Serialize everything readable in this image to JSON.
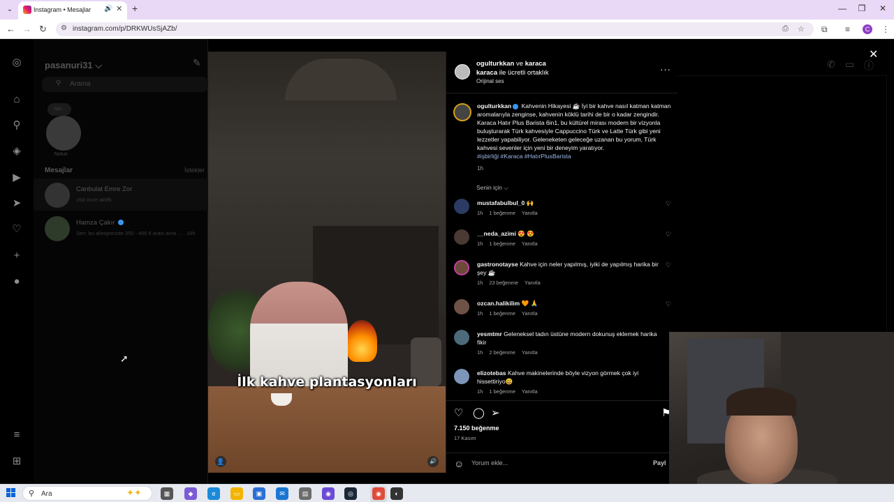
{
  "browser": {
    "tab_title": "Instagram • Mesajlar",
    "url": "instagram.com/p/DRKWUsSjAZb/",
    "profile_initial": "C"
  },
  "dm": {
    "username": "pasanuri31",
    "search_placeholder": "Arama",
    "note_bubble": "Not...",
    "note_label": "Notun",
    "section_title": "Mesajlar",
    "requests_label": "İstekler",
    "conversations": [
      {
        "name": "Canbulat Emre Zor",
        "sub": "16d önce aktifti"
      },
      {
        "name": "Hamza Çakır",
        "sub": "Sen: bu aliexpresste 350 - 400 tl arası ama ... · 16h"
      }
    ]
  },
  "post": {
    "header": {
      "author": "ogulturkkan",
      "conj": "ve",
      "partner": "karaca",
      "partner2": "karaca",
      "partnership": "ile ücretli ortaklık",
      "audio": "Orijinal ses"
    },
    "caption": {
      "user": "ogulturkkan",
      "text": "Kahvenin Hikayesi ☕ İyi bir kahve nasıl katman katman aromalarıyla zenginse, kahvenin köklü tarihi de bir o kadar zengindir. Karaca Hatır Plus Barista 6in1, bu kültürel mirası modern bir vizyonla buluşturarak Türk kahvesiyle Cappuccino Türk ve Latte Türk gibi yeni lezzetler yapabiliyor. Geleneketen geleceğe uzanan bu yorum, Türk kahvesi sevenler için yeni bir deneyim yaratıyor.",
      "tags": "#işbirliği #Karaca #HatırPlusBarista",
      "time": "1h"
    },
    "sort_label": "Senin için ⌵",
    "comments": [
      {
        "user": "mustafabulbul_0",
        "text": "🙌",
        "time": "1h",
        "likes": "1 beğenme",
        "reply": "Yanıtla"
      },
      {
        "user": "__neda_azimi",
        "text": "😍 😍",
        "time": "1h",
        "likes": "1 beğenme",
        "reply": "Yanıtla"
      },
      {
        "user": "gastronotayse",
        "text": "Kahve için neler yapılmış, iyiki de yapılmış harika bir şey ☕",
        "time": "1h",
        "likes": "23 beğenme",
        "reply": "Yanıtla"
      },
      {
        "user": "ozcan.halikilim",
        "text": "🧡 🙏",
        "time": "1h",
        "likes": "1 beğenme",
        "reply": "Yanıtla"
      },
      {
        "user": "yesmtmr",
        "text": "Geleneksel tadın üstüne modern dokunuş eklemek harika fikir",
        "time": "1h",
        "likes": "2 beğenme",
        "reply": "Yanıtla"
      },
      {
        "user": "elizotebas",
        "text": "Kahve makinelerinde böyle vizyon görmek çok iyi hissettiriyo😃",
        "time": "1h",
        "likes": "1 beğenme",
        "reply": "Yanıtla"
      }
    ],
    "likes": "7.150 beğenme",
    "date": "17 Kasım",
    "comment_placeholder": "Yorum ekle...",
    "post_button": "Payl"
  },
  "video": {
    "subtitle": "İlk kahve plantasyonları"
  },
  "taskbar": {
    "search_text": "Ara"
  }
}
